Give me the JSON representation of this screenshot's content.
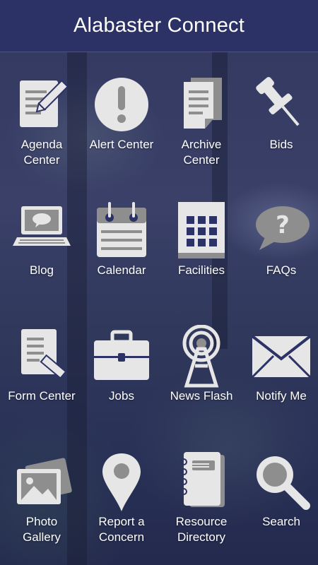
{
  "app": {
    "title": "Alabaster Connect"
  },
  "tiles": [
    {
      "label1": "Agenda",
      "label2": "Center",
      "icon": "agenda-icon"
    },
    {
      "label1": "Alert Center",
      "label2": "",
      "icon": "alert-icon"
    },
    {
      "label1": "Archive",
      "label2": "Center",
      "icon": "archive-icon"
    },
    {
      "label1": "Bids",
      "label2": "",
      "icon": "pushpin-icon"
    },
    {
      "label1": "Blog",
      "label2": "",
      "icon": "laptop-icon"
    },
    {
      "label1": "Calendar",
      "label2": "",
      "icon": "calendar-icon"
    },
    {
      "label1": "Facilities",
      "label2": "",
      "icon": "building-icon"
    },
    {
      "label1": "FAQs",
      "label2": "",
      "icon": "question-bubble-icon"
    },
    {
      "label1": "Form Center",
      "label2": "",
      "icon": "form-icon"
    },
    {
      "label1": "Jobs",
      "label2": "",
      "icon": "briefcase-icon"
    },
    {
      "label1": "News Flash",
      "label2": "",
      "icon": "broadcast-tower-icon"
    },
    {
      "label1": "Notify Me",
      "label2": "",
      "icon": "envelope-icon"
    },
    {
      "label1": "Photo",
      "label2": "Gallery",
      "icon": "photo-icon"
    },
    {
      "label1": "Report a",
      "label2": "Concern",
      "icon": "map-pin-icon"
    },
    {
      "label1": "Resource",
      "label2": "Directory",
      "icon": "notebook-icon"
    },
    {
      "label1": "Search",
      "label2": "",
      "icon": "magnifier-icon"
    }
  ],
  "colors": {
    "header": "#2c3266",
    "icon": "#e6e6e6",
    "icon_dark": "#8e8e8e"
  }
}
